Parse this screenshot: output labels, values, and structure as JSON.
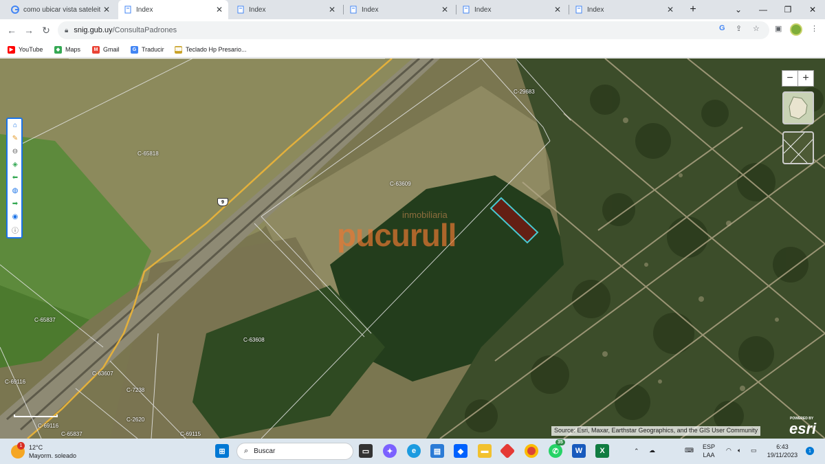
{
  "browser": {
    "tabs": [
      {
        "title": "como ubicar vista sateleita",
        "active": false,
        "icon": "google-icon"
      },
      {
        "title": "Index",
        "active": true,
        "icon": "page-icon"
      },
      {
        "title": "Index",
        "active": false,
        "icon": "page-icon"
      },
      {
        "title": "Index",
        "active": false,
        "icon": "page-icon"
      },
      {
        "title": "Index",
        "active": false,
        "icon": "page-icon"
      },
      {
        "title": "Index",
        "active": false,
        "icon": "page-icon"
      }
    ],
    "new_tab_label": "+",
    "url_host": "snig.gub.uy",
    "url_path": "/ConsultaPadrones",
    "bookmarks": [
      {
        "label": "YouTube",
        "icon": "youtube-icon",
        "color": "#ff0000"
      },
      {
        "label": "Maps",
        "icon": "maps-icon",
        "color": "#34a853"
      },
      {
        "label": "Gmail",
        "icon": "gmail-icon",
        "color": "#ea4335"
      },
      {
        "label": "Traducir",
        "icon": "translate-icon",
        "color": "#4285f4"
      },
      {
        "label": "Teclado Hp Presario...",
        "icon": "keyboard-icon",
        "color": "#c9a227"
      }
    ]
  },
  "map": {
    "parcel_labels": [
      {
        "text": "C-65818"
      },
      {
        "text": "C-63609"
      },
      {
        "text": "C-29683"
      },
      {
        "text": "C-65837"
      },
      {
        "text": "C-63608"
      },
      {
        "text": "C-63607"
      },
      {
        "text": "C-69116"
      },
      {
        "text": "C-7238"
      },
      {
        "text": "C-2620"
      },
      {
        "text": "C-69116"
      },
      {
        "text": "C-65837"
      },
      {
        "text": "C-69115"
      }
    ],
    "route_number": "9",
    "watermark_sub": "inmobiliaria",
    "watermark_main": "pucurull",
    "zoom_out_label": "−",
    "zoom_in_label": "+",
    "attribution": "Source: Esri, Maxar, Earthstar Geographics, and the GIS User Community",
    "esri_powered": "POWERED BY",
    "esri_logo": "esri",
    "highlight_color": "#4dd9e6"
  },
  "taskbar": {
    "temperature": "12°C",
    "weather_text": "Mayorm. soleado",
    "weather_badge": "1",
    "search_placeholder": "Buscar",
    "whatsapp_badge": "35",
    "language_top": "ESP",
    "language_bottom": "LAA",
    "time": "6:43",
    "date": "19/11/2023",
    "notification_badge": "1"
  }
}
